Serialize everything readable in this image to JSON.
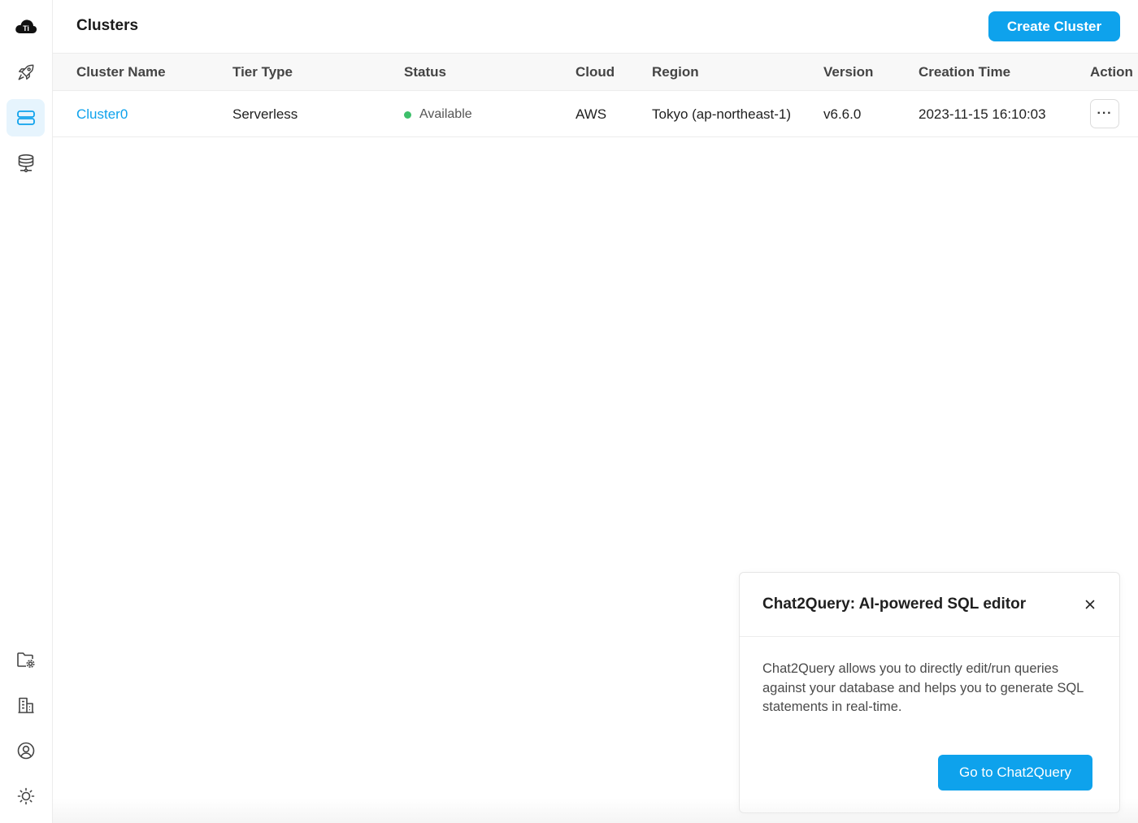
{
  "sidebar": {
    "logo_icon": "cloud-logo-icon",
    "top_items": [
      {
        "name": "getting-started",
        "icon": "rocket-icon"
      },
      {
        "name": "clusters",
        "icon": "clusters-icon",
        "active": true
      },
      {
        "name": "data-service",
        "icon": "database-network-icon"
      }
    ],
    "bottom_items": [
      {
        "name": "project-settings",
        "icon": "folder-settings-icon"
      },
      {
        "name": "organization",
        "icon": "building-icon"
      },
      {
        "name": "account",
        "icon": "user-circle-icon"
      },
      {
        "name": "theme",
        "icon": "sun-icon"
      }
    ]
  },
  "header": {
    "title": "Clusters",
    "create_button": "Create Cluster"
  },
  "table": {
    "columns": [
      "Cluster Name",
      "Tier Type",
      "Status",
      "Cloud",
      "Region",
      "Version",
      "Creation Time",
      "Action"
    ],
    "rows": [
      {
        "name": "Cluster0",
        "tier": "Serverless",
        "status": "Available",
        "cloud": "AWS",
        "region": "Tokyo (ap-northeast-1)",
        "version": "v6.6.0",
        "created": "2023-11-15 16:10:03",
        "action": "···"
      }
    ]
  },
  "popup": {
    "title": "Chat2Query: AI-powered SQL editor",
    "body": "Chat2Query allows you to directly edit/run queries against your database and helps you to generate SQL statements in real-time.",
    "button": "Go to Chat2Query"
  },
  "colors": {
    "accent": "#0ea2ec",
    "status_available": "#3dbf6a",
    "active_nav_bg": "#e6f4fd"
  }
}
